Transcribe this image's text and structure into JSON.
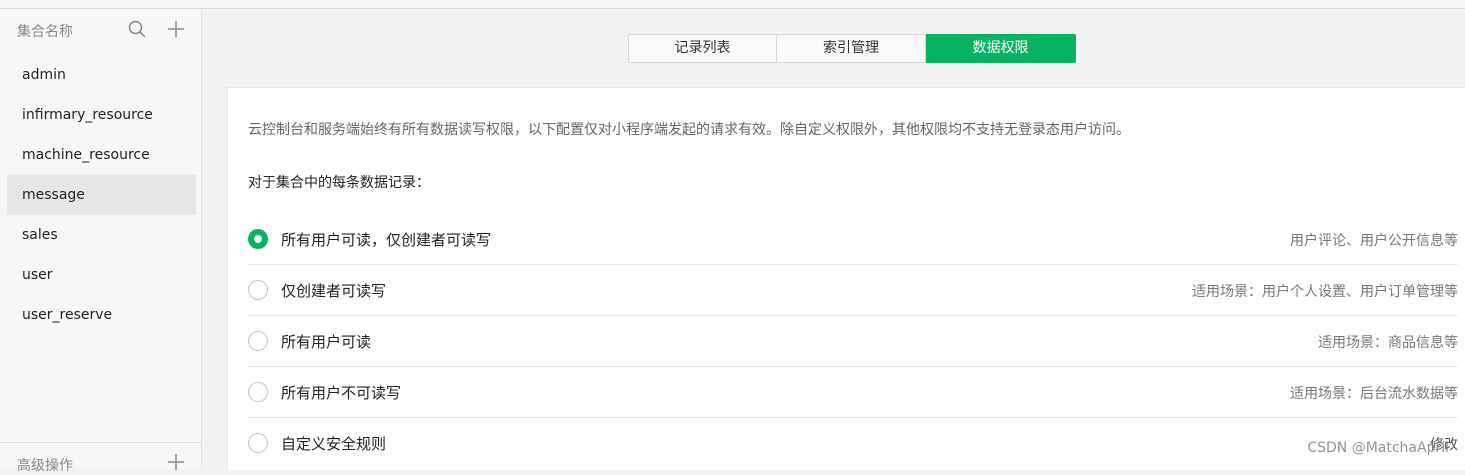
{
  "sidebar": {
    "title": "集合名称",
    "collections": [
      "admin",
      "infirmary_resource",
      "machine_resource",
      "message",
      "sales",
      "user",
      "user_reserve"
    ],
    "active_index": 3,
    "advanced_title": "高级操作"
  },
  "tabs": [
    {
      "label": "记录列表"
    },
    {
      "label": "索引管理"
    },
    {
      "label": "数据权限"
    }
  ],
  "active_tab": 2,
  "accent_color": "#07b362",
  "permissions": {
    "description": "云控制台和服务端始终有所有数据读写权限，以下配置仅对小程序端发起的请求有效。除自定义权限外，其他权限均不支持无登录态用户访问。",
    "subtitle": "对于集合中的每条数据记录：",
    "options": [
      {
        "label": "所有用户可读，仅创建者可读写",
        "hint": "用户评论、用户公开信息等",
        "selected": true
      },
      {
        "label": "仅创建者可读写",
        "hint": "适用场景：用户个人设置、用户订单管理等",
        "selected": false
      },
      {
        "label": "所有用户可读",
        "hint": "适用场景：商品信息等",
        "selected": false
      },
      {
        "label": "所有用户不可读写",
        "hint": "适用场景：后台流水数据等",
        "selected": false
      },
      {
        "label": "自定义安全规则",
        "hint": "修改",
        "selected": false
      }
    ]
  },
  "watermark": "CSDN @MatchaApril"
}
